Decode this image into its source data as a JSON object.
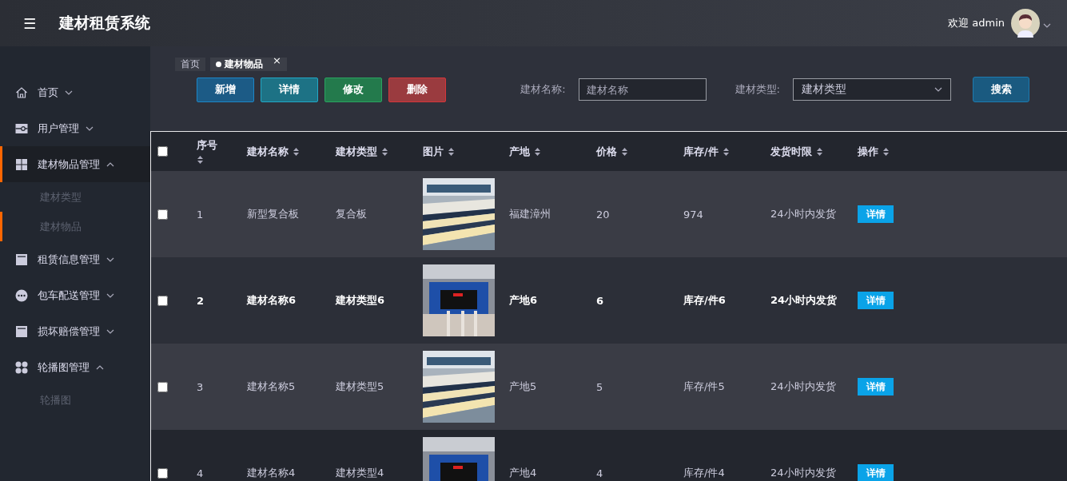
{
  "header": {
    "menu_icon": "☰",
    "title": "建材租赁系统",
    "welcome": "欢迎 admin"
  },
  "sidebar": {
    "items": [
      {
        "label": "首页",
        "expanded": false,
        "selected": false
      },
      {
        "label": "用户管理",
        "expanded": false,
        "selected": false
      },
      {
        "label": "建材物品管理",
        "expanded": true,
        "selected": true,
        "children": [
          {
            "label": "建材类型",
            "selected": false
          },
          {
            "label": "建材物品",
            "selected": true
          }
        ]
      },
      {
        "label": "租赁信息管理",
        "expanded": false,
        "selected": false
      },
      {
        "label": "包车配送管理",
        "expanded": false,
        "selected": false
      },
      {
        "label": "损坏赔偿管理",
        "expanded": false,
        "selected": false
      },
      {
        "label": "轮播图管理",
        "expanded": true,
        "selected": false,
        "children": [
          {
            "label": "轮播图",
            "selected": false
          }
        ]
      }
    ]
  },
  "tabs": [
    {
      "label": "首页",
      "selected": false
    },
    {
      "label": "建材物品",
      "selected": true,
      "close": "×"
    }
  ],
  "actions": [
    {
      "label": "新增",
      "kind": "add"
    },
    {
      "label": "详情",
      "kind": "detail"
    },
    {
      "label": "修改",
      "kind": "edit"
    },
    {
      "label": "删除",
      "kind": "delete"
    }
  ],
  "search": {
    "name_label": "建材名称:",
    "name_placeholder": "建材名称",
    "type_label": "建材类型:",
    "type_placeholder": "建材类型",
    "button": "搜索"
  },
  "table": {
    "select_all": false,
    "columns": [
      "序号",
      "建材名称",
      "建材类型",
      "图片",
      "产地",
      "价格",
      "库存/件",
      "发货时限",
      "操作"
    ],
    "rows": [
      {
        "checked": false,
        "highlighted": false,
        "cells": [
          "1",
          "新型复合板",
          "复合板",
          {
            "kind": "picture"
          },
          "福建漳州",
          "20",
          "974",
          "24小时内发货",
          "详情"
        ]
      },
      {
        "checked": false,
        "highlighted": true,
        "cells": [
          "2",
          "建材名称6",
          "建材类型6",
          {
            "kind": "picture"
          },
          "产地6",
          "6",
          "库存/件6",
          "24小时内发货",
          "详情"
        ]
      },
      {
        "checked": false,
        "highlighted": false,
        "cells": [
          "3",
          "建材名称5",
          "建材类型5",
          {
            "kind": "picture"
          },
          "产地5",
          "5",
          "库存/件5",
          "24小时内发货",
          "详情"
        ]
      },
      {
        "checked": false,
        "highlighted": false,
        "cells": [
          "4",
          "建材名称4",
          "建材类型4",
          {
            "kind": "picture"
          },
          "产地4",
          "4",
          "库存/件4",
          "24小时内发货",
          "详情"
        ]
      }
    ]
  }
}
